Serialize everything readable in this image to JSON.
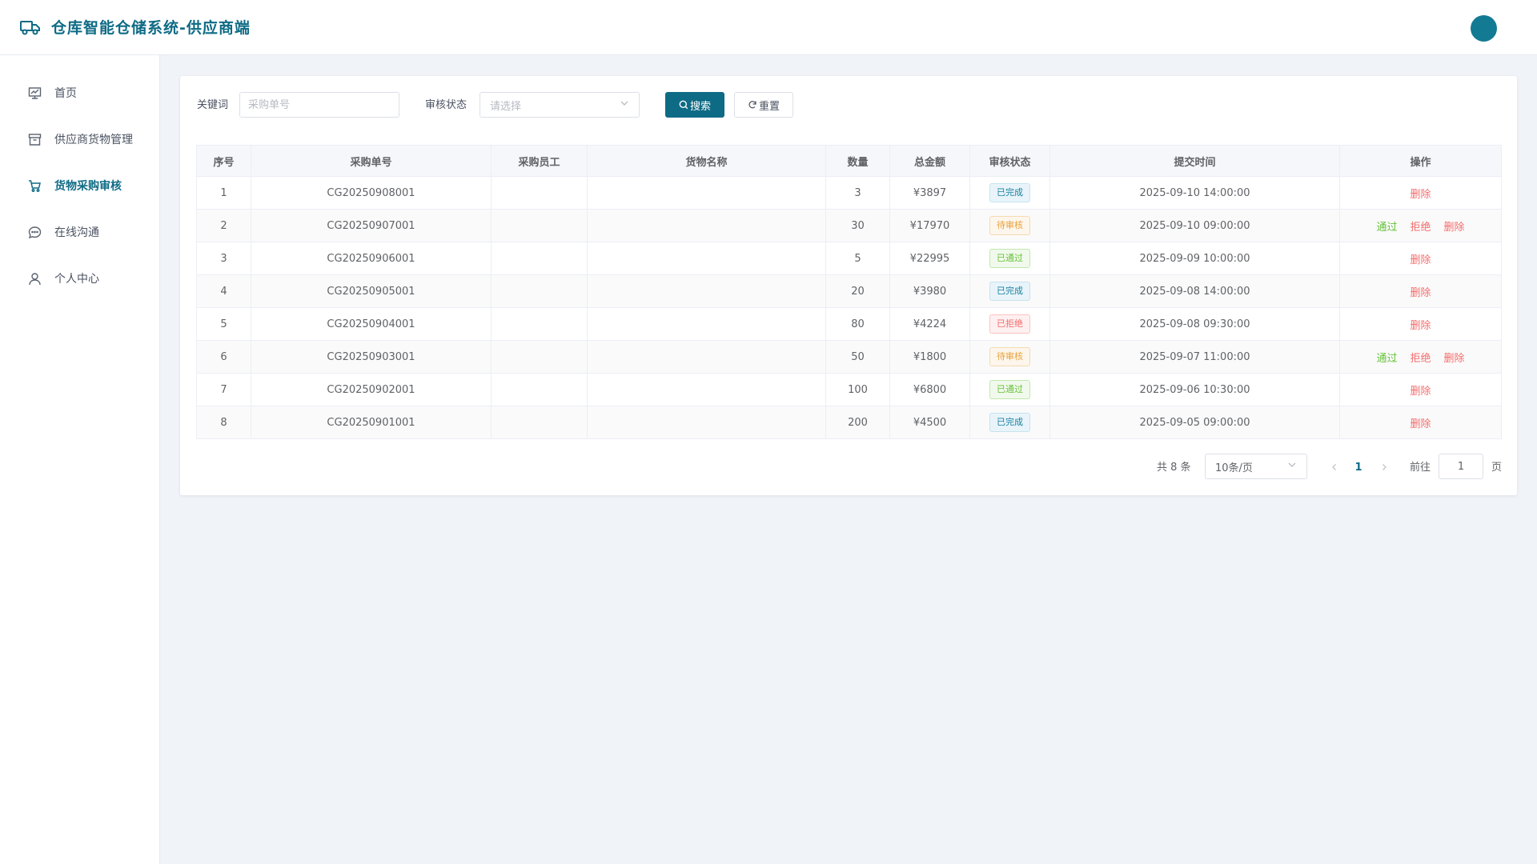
{
  "header": {
    "title": "仓库智能仓储系统-供应商端",
    "logo_icon": "truck-icon",
    "avatar_color": "#137a93"
  },
  "sidebar": {
    "items": [
      {
        "label": "首页",
        "icon": "dashboard-icon",
        "active": false
      },
      {
        "label": "供应商货物管理",
        "icon": "archive-box-icon",
        "active": false
      },
      {
        "label": "货物采购审核",
        "icon": "shopping-cart-icon",
        "active": true
      },
      {
        "label": "在线沟通",
        "icon": "chat-bubble-icon",
        "active": false
      },
      {
        "label": "个人中心",
        "icon": "user-icon",
        "active": false
      }
    ]
  },
  "filters": {
    "keyword_label": "关键词",
    "keyword_placeholder": "采购单号",
    "keyword_value": "",
    "status_label": "审核状态",
    "status_placeholder": "请选择",
    "search_label": "搜索",
    "reset_label": "重置"
  },
  "table": {
    "columns": [
      "序号",
      "采购单号",
      "采购员工",
      "货物名称",
      "数量",
      "总金额",
      "审核状态",
      "提交时间",
      "操作"
    ],
    "rows": [
      {
        "index": "1",
        "order_no": "CG20250908001",
        "staff": "",
        "goods": "",
        "qty": "3",
        "amount": "¥3897",
        "status": "已完成",
        "status_type": "done",
        "time": "2025-09-10 14:00:00",
        "actions": [
          "删除"
        ]
      },
      {
        "index": "2",
        "order_no": "CG20250907001",
        "staff": "",
        "goods": "",
        "qty": "30",
        "amount": "¥17970",
        "status": "待审核",
        "status_type": "pending",
        "time": "2025-09-10 09:00:00",
        "actions": [
          "通过",
          "拒绝",
          "删除"
        ]
      },
      {
        "index": "3",
        "order_no": "CG20250906001",
        "staff": "",
        "goods": "",
        "qty": "5",
        "amount": "¥22995",
        "status": "已通过",
        "status_type": "passed",
        "time": "2025-09-09 10:00:00",
        "actions": [
          "删除"
        ]
      },
      {
        "index": "4",
        "order_no": "CG20250905001",
        "staff": "",
        "goods": "",
        "qty": "20",
        "amount": "¥3980",
        "status": "已完成",
        "status_type": "done",
        "time": "2025-09-08 14:00:00",
        "actions": [
          "删除"
        ]
      },
      {
        "index": "5",
        "order_no": "CG20250904001",
        "staff": "",
        "goods": "",
        "qty": "80",
        "amount": "¥4224",
        "status": "已拒绝",
        "status_type": "rejected",
        "time": "2025-09-08 09:30:00",
        "actions": [
          "删除"
        ]
      },
      {
        "index": "6",
        "order_no": "CG20250903001",
        "staff": "",
        "goods": "",
        "qty": "50",
        "amount": "¥1800",
        "status": "待审核",
        "status_type": "pending",
        "time": "2025-09-07 11:00:00",
        "actions": [
          "通过",
          "拒绝",
          "删除"
        ]
      },
      {
        "index": "7",
        "order_no": "CG20250902001",
        "staff": "",
        "goods": "",
        "qty": "100",
        "amount": "¥6800",
        "status": "已通过",
        "status_type": "passed",
        "time": "2025-09-06 10:30:00",
        "actions": [
          "删除"
        ]
      },
      {
        "index": "8",
        "order_no": "CG20250901001",
        "staff": "",
        "goods": "",
        "qty": "200",
        "amount": "¥4500",
        "status": "已完成",
        "status_type": "done",
        "time": "2025-09-05 09:00:00",
        "actions": [
          "删除"
        ]
      }
    ]
  },
  "pagination": {
    "total_text": "共 8 条",
    "page_size": "10条/页",
    "current_page": "1",
    "goto_label": "前往",
    "goto_value": "1",
    "page_suffix": "页"
  },
  "colors": {
    "brand": "#0e6b85",
    "pass": "#67c23a",
    "reject": "#f56c6c",
    "pending": "#e6a23c"
  }
}
